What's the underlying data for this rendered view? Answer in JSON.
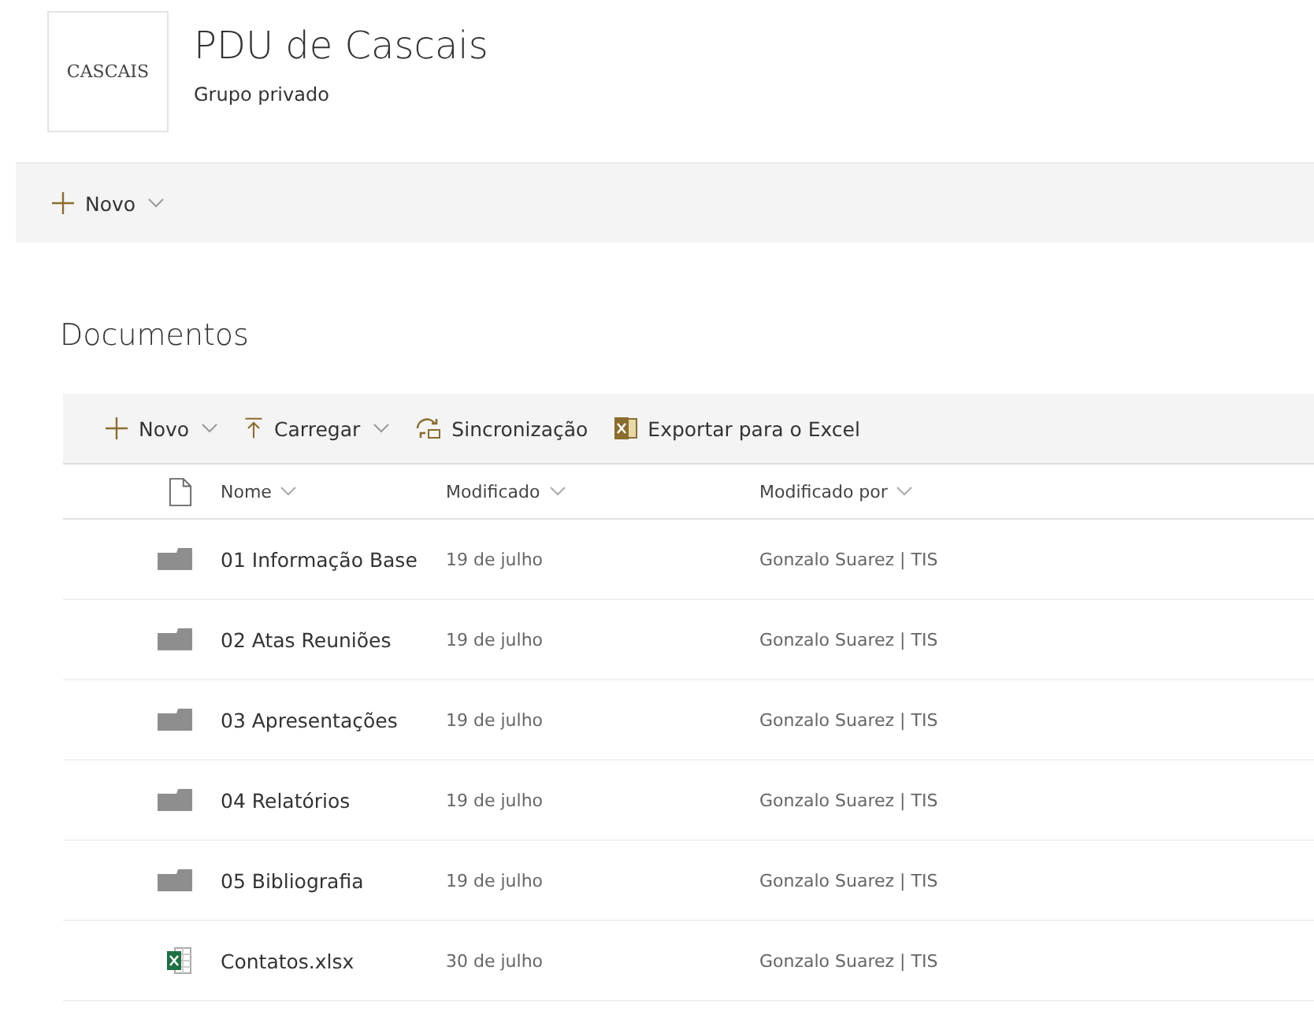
{
  "site": {
    "logo": "CASCAIS",
    "title": "PDU de Cascais",
    "subtitle": "Grupo privado"
  },
  "top_bar": {
    "new_button": {
      "label": "Novo",
      "dropdown": true
    }
  },
  "library": {
    "title": "Documentos",
    "commands": [
      {
        "kind": "new",
        "label": "Novo",
        "dropdown": true
      },
      {
        "kind": "upload",
        "label": "Carregar",
        "dropdown": true
      },
      {
        "kind": "sync",
        "label": "Sincronização",
        "dropdown": false
      },
      {
        "kind": "excel",
        "label": "Exportar para o Excel",
        "dropdown": false
      }
    ],
    "columns": [
      "Nome",
      "Modificado",
      "Modificado por"
    ],
    "rows": [
      {
        "kind": "folder",
        "name": "01 Informação Base",
        "modified": "19 de julho",
        "modified_by": "Gonzalo Suarez | TIS"
      },
      {
        "kind": "folder",
        "name": "02 Atas Reuniões",
        "modified": "19 de julho",
        "modified_by": "Gonzalo Suarez | TIS"
      },
      {
        "kind": "folder",
        "name": "03 Apresentações",
        "modified": "19 de julho",
        "modified_by": "Gonzalo Suarez | TIS"
      },
      {
        "kind": "folder",
        "name": "04 Relatórios",
        "modified": "19 de julho",
        "modified_by": "Gonzalo Suarez | TIS"
      },
      {
        "kind": "folder",
        "name": "05 Bibliografia",
        "modified": "19 de julho",
        "modified_by": "Gonzalo Suarez | TIS"
      },
      {
        "kind": "excel",
        "name": "Contatos.xlsx",
        "modified": "30 de julho",
        "modified_by": "Gonzalo Suarez | TIS"
      }
    ]
  }
}
